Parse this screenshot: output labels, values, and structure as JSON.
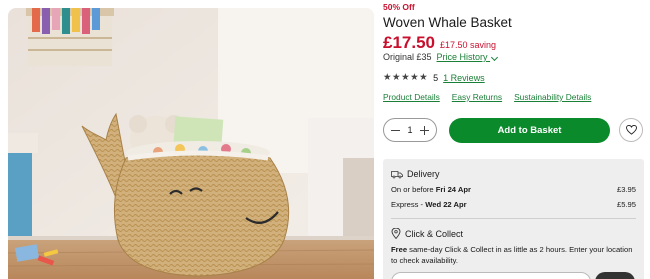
{
  "product": {
    "discount_badge": "50% Off",
    "title": "Woven Whale Basket",
    "price": "£17.50",
    "saving": "£17.50 saving",
    "original_price": "Original £35",
    "price_history_label": "Price History",
    "rating_stars": 5,
    "rating_value": "5",
    "reviews_link": "1 Reviews"
  },
  "tabs": {
    "product_details": "Product Details",
    "easy_returns": "Easy Returns",
    "sustainability": "Sustainability Details"
  },
  "purchase": {
    "quantity": "1",
    "add_to_basket": "Add to Basket"
  },
  "delivery": {
    "heading": "Delivery",
    "option1_label": "On or before ",
    "option1_date": "Fri 24 Apr",
    "option1_price": "£3.95",
    "option2_label": "Express - ",
    "option2_date": "Wed 22 Apr",
    "option2_price": "£5.95"
  },
  "click_collect": {
    "heading": "Click & Collect",
    "bold_text": "Free",
    "text": " same-day Click & Collect in as little as 2 hours. Enter your location to check availability."
  },
  "colors": {
    "sale_red": "#c8102e",
    "link_green": "#1a7f37",
    "button_green": "#0a8a2a",
    "panel_grey": "#eeeeee"
  },
  "icons": {
    "wishlist": "heart-icon",
    "delivery": "van-icon",
    "click_collect": "location-pin-icon",
    "price_history": "chevron-down-icon"
  }
}
